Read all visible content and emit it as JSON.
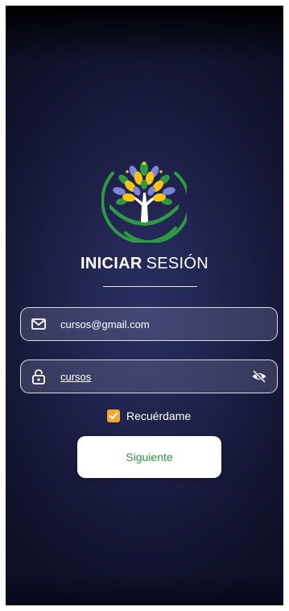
{
  "login": {
    "title_bold": "INICIAR",
    "title_light": "SESIÓN",
    "email": {
      "value": "cursos@gmail.com",
      "icon": "mail-icon"
    },
    "password": {
      "value": "cursos",
      "icon": "lock-icon",
      "toggle_icon": "eye-off-icon"
    },
    "remember": {
      "label": "Recuérdame",
      "checked": true
    },
    "next_button": "Siguiente"
  },
  "colors": {
    "background": "#1d2148",
    "accent_green": "#2e9a43",
    "checkbox": "#f4a72c",
    "field_border": "#d9dae6"
  }
}
